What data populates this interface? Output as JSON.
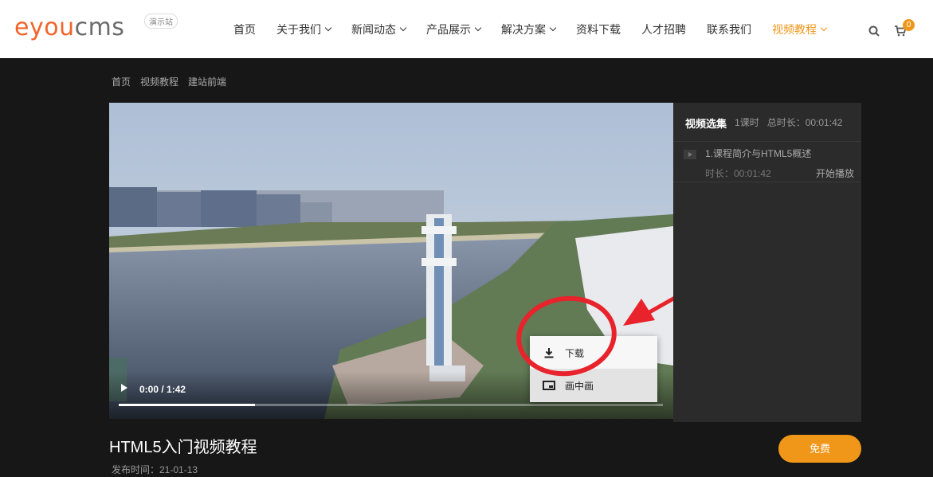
{
  "header": {
    "logo": {
      "e": "e",
      "you": "you",
      "cms": "cms"
    },
    "demo_badge": "演示站",
    "nav": [
      {
        "label": "首页",
        "dropdown": false,
        "active": false
      },
      {
        "label": "关于我们",
        "dropdown": true,
        "active": false
      },
      {
        "label": "新闻动态",
        "dropdown": true,
        "active": false
      },
      {
        "label": "产品展示",
        "dropdown": true,
        "active": false
      },
      {
        "label": "解决方案",
        "dropdown": true,
        "active": false
      },
      {
        "label": "资料下载",
        "dropdown": false,
        "active": false
      },
      {
        "label": "人才招聘",
        "dropdown": false,
        "active": false
      },
      {
        "label": "联系我们",
        "dropdown": false,
        "active": false
      },
      {
        "label": "视频教程",
        "dropdown": true,
        "active": true
      }
    ],
    "cart_count": "0"
  },
  "breadcrumb": [
    "首页",
    "视频教程",
    "建站前端"
  ],
  "player": {
    "time": "0:00 / 1:42",
    "progress": 0.25
  },
  "context_menu": {
    "download": "下载",
    "pip": "画中画"
  },
  "playlist": {
    "title": "视频选集",
    "count": "1课时",
    "total": "总时长：00:01:42",
    "items": [
      {
        "title": "1.课程简介与HTML5概述",
        "duration": "时长：00:01:42",
        "action": "开始播放"
      }
    ]
  },
  "course": {
    "title": "HTML5入门视频教程",
    "publish": "发布时间：21-01-13",
    "price_button": "免费"
  },
  "colors": {
    "accent": "#f0971a",
    "brand": "#f0652a",
    "annotation": "#e8232b"
  }
}
